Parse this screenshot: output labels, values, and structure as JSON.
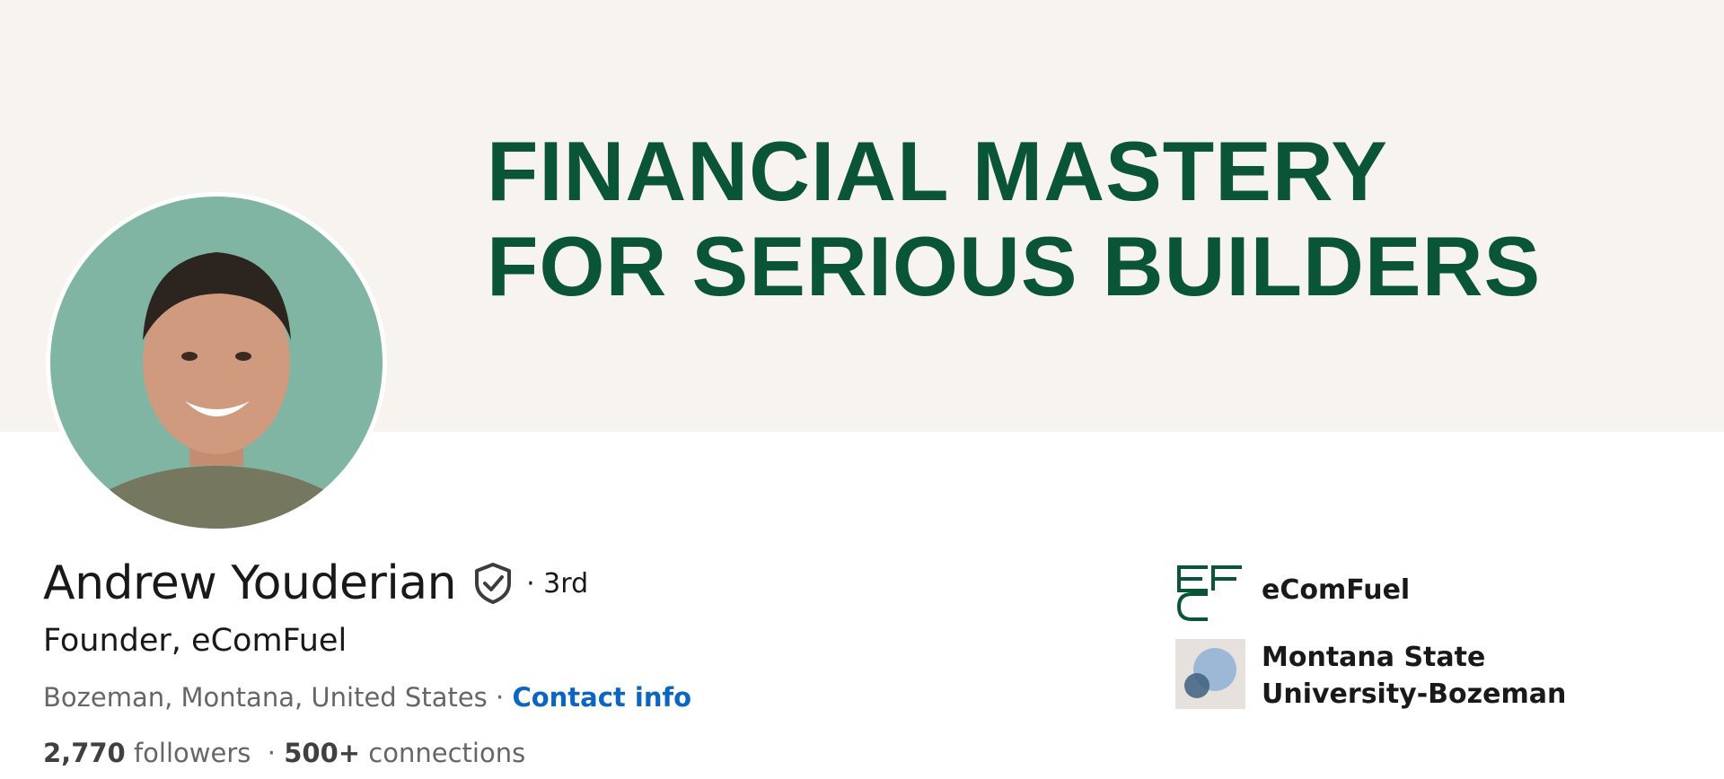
{
  "banner": {
    "headline_line1": "FINANCIAL MASTERY",
    "headline_line2": "FOR SERIOUS BUILDERS",
    "background_color": "#f7f3ef",
    "text_color": "#0b5537"
  },
  "profile": {
    "name": "Andrew Youderian",
    "verified_icon": "verified-shield-icon",
    "degree": "· 3rd",
    "headline": "Founder, eComFuel",
    "location": "Bozeman, Montana, United States",
    "location_separator": " · ",
    "contact_info_label": "Contact info",
    "followers_count": "2,770",
    "followers_label": " followers",
    "stats_separator": "  · ",
    "connections_count": "500+",
    "connections_label": " connections"
  },
  "affiliations": [
    {
      "name": "eComFuel",
      "logo_icon": "ecomfuel-logo"
    },
    {
      "name": "Montana State University-Bozeman",
      "logo_icon": "msu-logo"
    }
  ],
  "colors": {
    "link": "#0a66c2",
    "secondary_text": "#666666",
    "brand_green": "#0b5537"
  }
}
